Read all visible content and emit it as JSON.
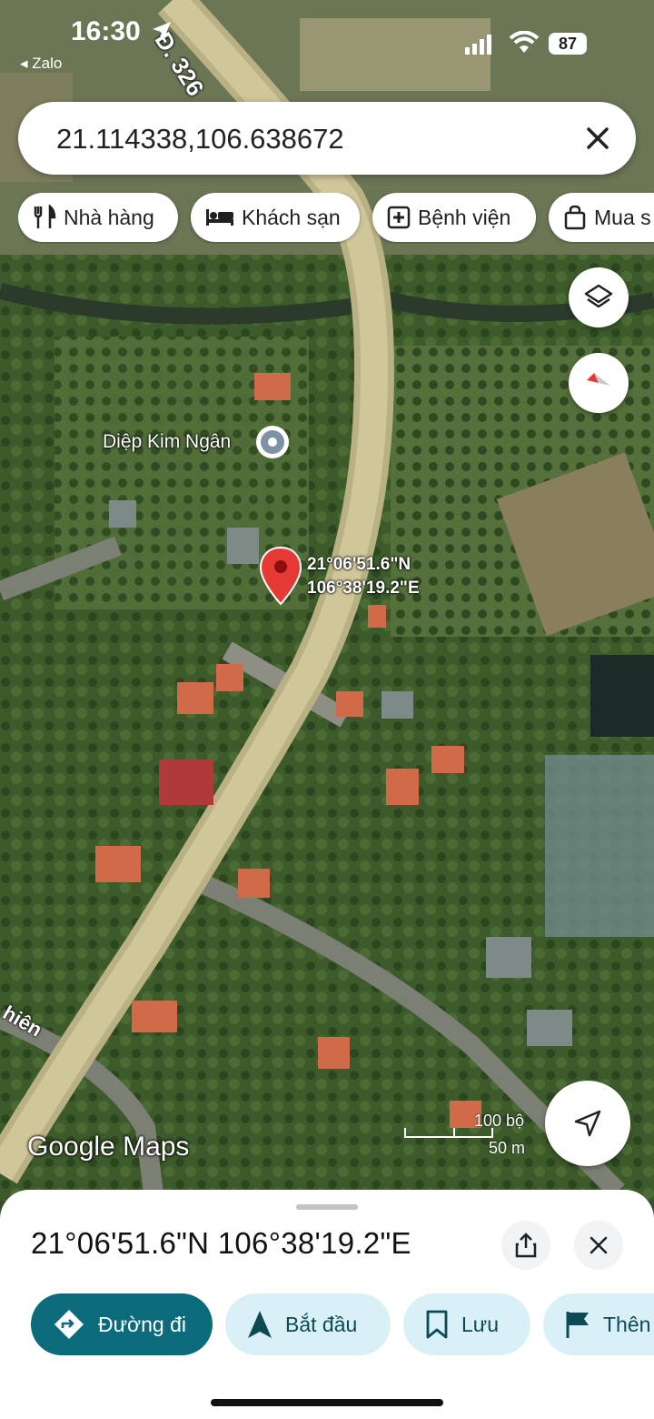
{
  "status_bar": {
    "time": "16:30",
    "back_app": "◂ Zalo",
    "battery": "87"
  },
  "search": {
    "value": "21.114338,106.638672",
    "clear_icon": "close-icon"
  },
  "chips": [
    {
      "label": "Nhà hàng",
      "icon": "restaurant-icon"
    },
    {
      "label": "Khách sạn",
      "icon": "hotel-icon"
    },
    {
      "label": "Bệnh viện",
      "icon": "hospital-icon"
    },
    {
      "label": "Mua s",
      "icon": "shopping-icon"
    }
  ],
  "map": {
    "road_label": "Đ. 326",
    "road_label_2": "hiên",
    "place_label": "Diệp Kim Ngân",
    "pin_label_lat": "21°06'51.6\"N",
    "pin_label_lng": "106°38'19.2\"E",
    "scale_ft": "100 bộ",
    "scale_m": "50 m",
    "brand": "Google Maps"
  },
  "sheet": {
    "coordinates": "21°06'51.6\"N 106°38'19.2\"E",
    "actions": [
      {
        "label": "Đường đi",
        "icon": "directions-icon"
      },
      {
        "label": "Bắt đầu",
        "icon": "navigation-icon"
      },
      {
        "label": "Lưu",
        "icon": "bookmark-icon"
      },
      {
        "label": "Thên",
        "icon": "flag-icon"
      }
    ]
  },
  "colors": {
    "accent": "#0b6b7a",
    "action_bg": "#d9f1f6",
    "pin": "#e53935"
  }
}
